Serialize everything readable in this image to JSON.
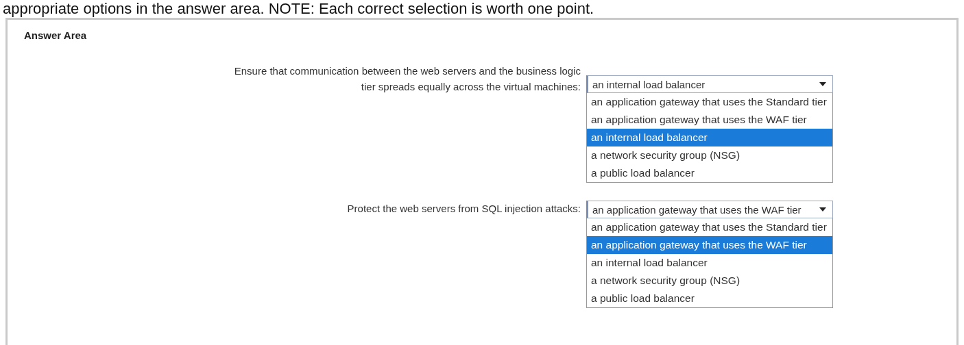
{
  "instructions": "appropriate options in the answer area. NOTE: Each correct selection is worth one point.",
  "answer_area": {
    "title": "Answer Area",
    "questions": [
      {
        "prompt": "Ensure that communication between the web servers and the business logic tier spreads equally across the virtual machines:",
        "value": "an internal load balancer",
        "options": [
          {
            "label": "an application gateway that uses the Standard tier",
            "selected": false
          },
          {
            "label": "an application gateway that uses the WAF tier",
            "selected": false
          },
          {
            "label": "an internal load balancer",
            "selected": true
          },
          {
            "label": "a network security group (NSG)",
            "selected": false
          },
          {
            "label": "a public load balancer",
            "selected": false
          }
        ]
      },
      {
        "prompt": "Protect the web servers from SQL injection attacks:",
        "value": "an application gateway that uses the WAF tier",
        "options": [
          {
            "label": "an application gateway that uses the Standard tier",
            "selected": false
          },
          {
            "label": "an application gateway that uses the WAF tier",
            "selected": true
          },
          {
            "label": "an internal load balancer",
            "selected": false
          },
          {
            "label": "a network security group (NSG)",
            "selected": false
          },
          {
            "label": "a public load balancer",
            "selected": false
          }
        ]
      }
    ]
  }
}
